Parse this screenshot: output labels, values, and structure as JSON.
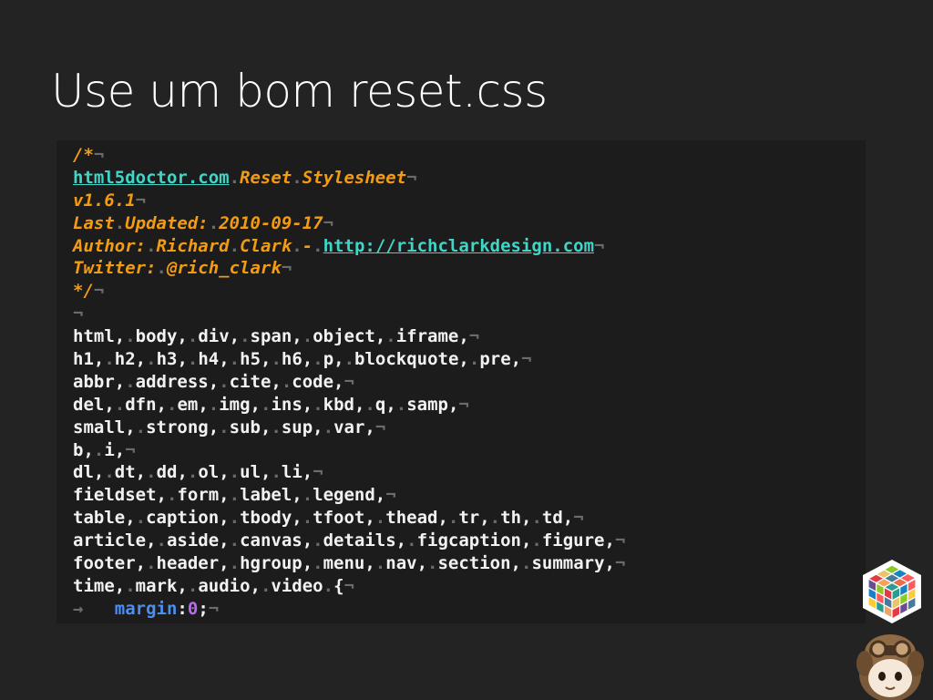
{
  "slide": {
    "title": "Use um bom reset.css"
  },
  "code": {
    "comment_lines": [
      "/*",
      "html5doctor.com Reset Stylesheet",
      "v1.6.1",
      "Last Updated: 2010-09-17",
      "Author: Richard Clark - ",
      "Twitter: @rich_clark",
      "*/"
    ],
    "author_url": "http://richclarkdesign.com",
    "site": "html5doctor.com",
    "selector_lines": [
      "html, body, div, span, object, iframe,",
      "h1, h2, h3, h4, h5, h6, p, blockquote, pre,",
      "abbr, address, cite, code,",
      "del, dfn, em, img, ins, kbd, q, samp,",
      "small, strong, sub, sup, var,",
      "b, i,",
      "dl, dt, dd, ol, ul, li,",
      "fieldset, form, label, legend,",
      "table, caption, tbody, tfoot, thead, tr, th, td,",
      "article, aside, canvas, details, figcaption, figure,",
      "footer, header, hgroup, menu, nav, section, summary,",
      "time, mark, audio, video {"
    ],
    "declaration": {
      "property": "margin",
      "value": "0"
    },
    "whitespace_markers": {
      "newline": "¬",
      "tab": "→",
      "space": "."
    }
  },
  "colors": {
    "background": "#232323",
    "comment": "#f39c12",
    "link": "#3fd6c8",
    "property": "#4a8ff2",
    "number": "#b86bf0"
  },
  "icons": [
    "rubik-cube-logo-icon",
    "aviator-mascot-icon"
  ]
}
